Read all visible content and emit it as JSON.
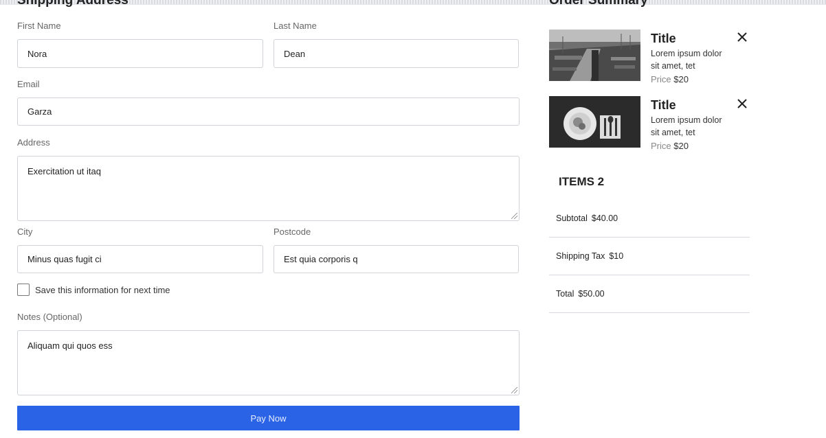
{
  "shipping": {
    "heading": "Shipping Address",
    "first_name": {
      "label": "First Name",
      "value": "Nora"
    },
    "last_name": {
      "label": "Last Name",
      "value": "Dean"
    },
    "email": {
      "label": "Email",
      "value": "Garza"
    },
    "address": {
      "label": "Address",
      "value": "Exercitation ut itaq"
    },
    "city": {
      "label": "City",
      "value": "Minus quas fugit ci"
    },
    "postcode": {
      "label": "Postcode",
      "value": "Est quia corporis q"
    },
    "save_info": {
      "label": "Save this information for next time",
      "checked": false
    },
    "notes": {
      "label": "Notes (Optional)",
      "value": "Aliquam qui quos ess"
    },
    "pay_button": "Pay Now"
  },
  "summary": {
    "heading": "Order Summary",
    "items": [
      {
        "title": "Title",
        "description": "Lorem ipsum dolor sit amet, tet",
        "price_label": "Price",
        "price": "$20",
        "image_icon": "marina-photo"
      },
      {
        "title": "Title",
        "description": "Lorem ipsum dolor sit amet, tet",
        "price_label": "Price",
        "price": "$20",
        "image_icon": "plate-cutlery-photo"
      }
    ],
    "items_count": "ITEMS 2",
    "rows": [
      {
        "label": "Subtotal",
        "value": "$40.00"
      },
      {
        "label": "Shipping Tax",
        "value": "$10"
      },
      {
        "label": "Total",
        "value": "$50.00"
      }
    ]
  },
  "colors": {
    "accent": "#2a63e6",
    "border": "#cfd3d8"
  }
}
